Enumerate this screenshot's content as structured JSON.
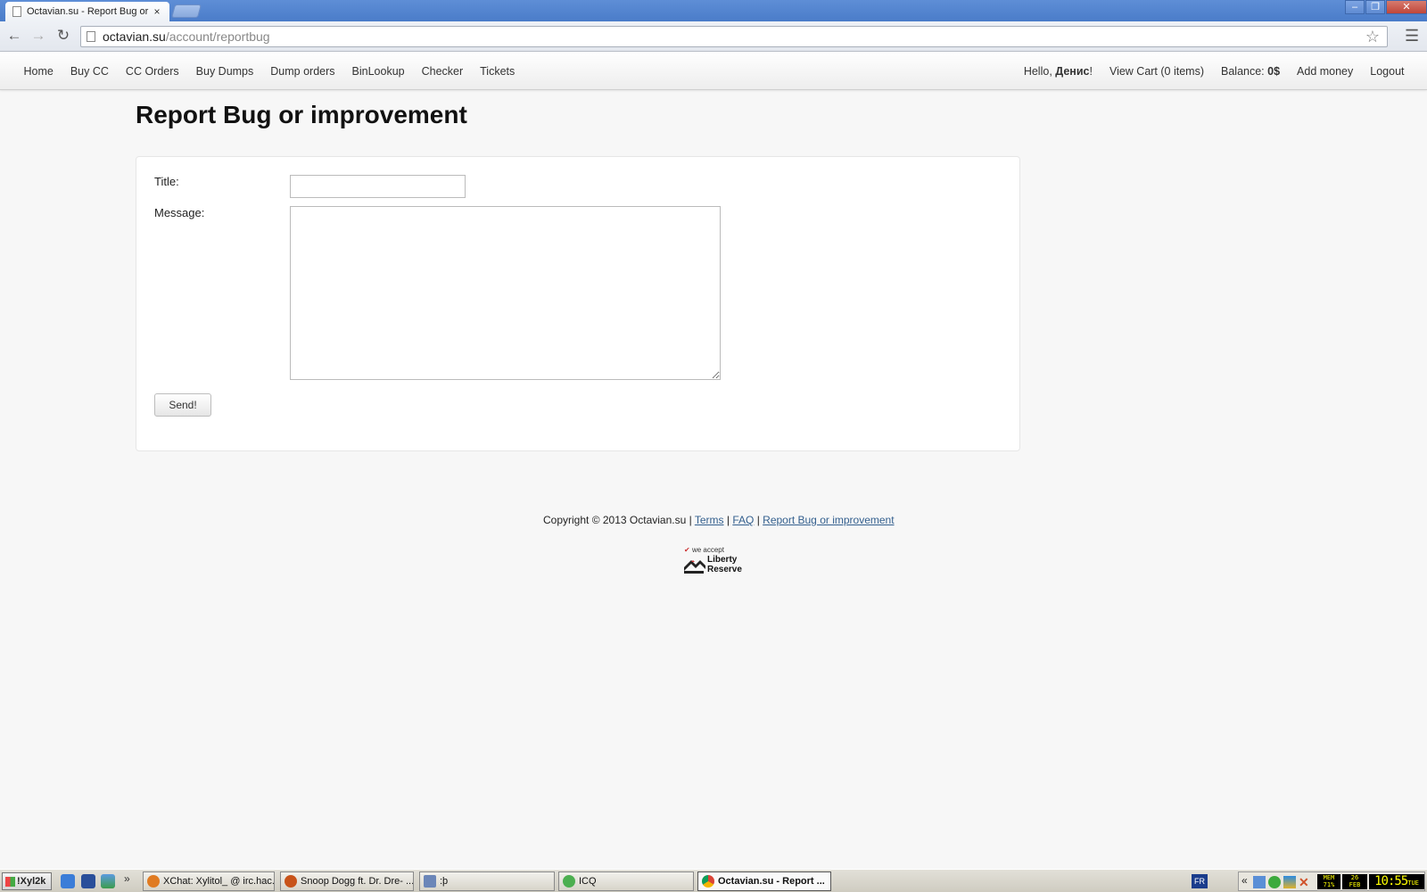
{
  "browser": {
    "tab_title": "Octavian.su - Report Bug or",
    "tab_close": "×",
    "url_host": "octavian.su",
    "url_path": "/account/reportbug",
    "window_controls": {
      "minimize": "–",
      "maximize": "❐",
      "close": "✕"
    }
  },
  "navbar": {
    "left": [
      "Home",
      "Buy CC",
      "CC Orders",
      "Buy Dumps",
      "Dump orders",
      "BinLookup",
      "Checker",
      "Tickets"
    ],
    "greeting_prefix": "Hello, ",
    "user_name": "Денис",
    "greeting_suffix": "!",
    "view_cart": "View Cart (0 items)",
    "balance_label": "Balance: ",
    "balance_value": "0$",
    "add_money": "Add money",
    "logout": "Logout"
  },
  "page": {
    "title": "Report Bug or improvement",
    "form": {
      "title_label": "Title:",
      "title_value": "",
      "message_label": "Message:",
      "message_value": "",
      "send_button": "Send!"
    }
  },
  "footer": {
    "copyright": "Copyright © 2013 Octavian.su |",
    "links": [
      "Terms",
      "FAQ",
      "Report Bug or improvement"
    ],
    "separator": "|",
    "badge_accept": "we accept",
    "badge_brand_line1": "Liberty",
    "badge_brand_line2": "Reserve"
  },
  "taskbar": {
    "start_label": "!Xyl2k",
    "quicklaunch_more": "»",
    "tasks": [
      {
        "label": "XChat: Xylitol_ @ irc.hac...",
        "icon_color": "#e07b22",
        "active": false
      },
      {
        "label": "Snoop Dogg ft. Dr. Dre- ...",
        "icon_color": "#c8531a",
        "active": false
      },
      {
        "label": ":þ",
        "icon_color": "#6b86b8",
        "active": false
      },
      {
        "label": "ICQ",
        "icon_color": "#4caf50",
        "active": false
      },
      {
        "label": "Octavian.su - Report ...",
        "icon_color": "#db4437",
        "active": true
      }
    ],
    "language": "FR",
    "tray_chevron": "«",
    "mem_label": "MEM",
    "mem_value": "71%",
    "date_day": "26",
    "date_month": "FEB",
    "time": "10:55",
    "weekday": "TUE"
  }
}
